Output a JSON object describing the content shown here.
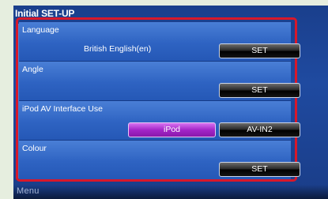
{
  "screen_title": "Initial SET-UP",
  "rows": [
    {
      "label": "Language",
      "value": "British English(en)",
      "button": "SET"
    },
    {
      "label": "Angle",
      "button": "SET"
    },
    {
      "label": "iPod AV Interface Use",
      "option_a": "iPod",
      "option_b": "AV-IN2",
      "selected": "iPod"
    },
    {
      "label": "Colour",
      "button": "SET"
    }
  ],
  "menu_label": "Menu",
  "colors": {
    "frame": "#d8182a",
    "selected_option": "#a326c8",
    "background": "#1f4aa0"
  }
}
